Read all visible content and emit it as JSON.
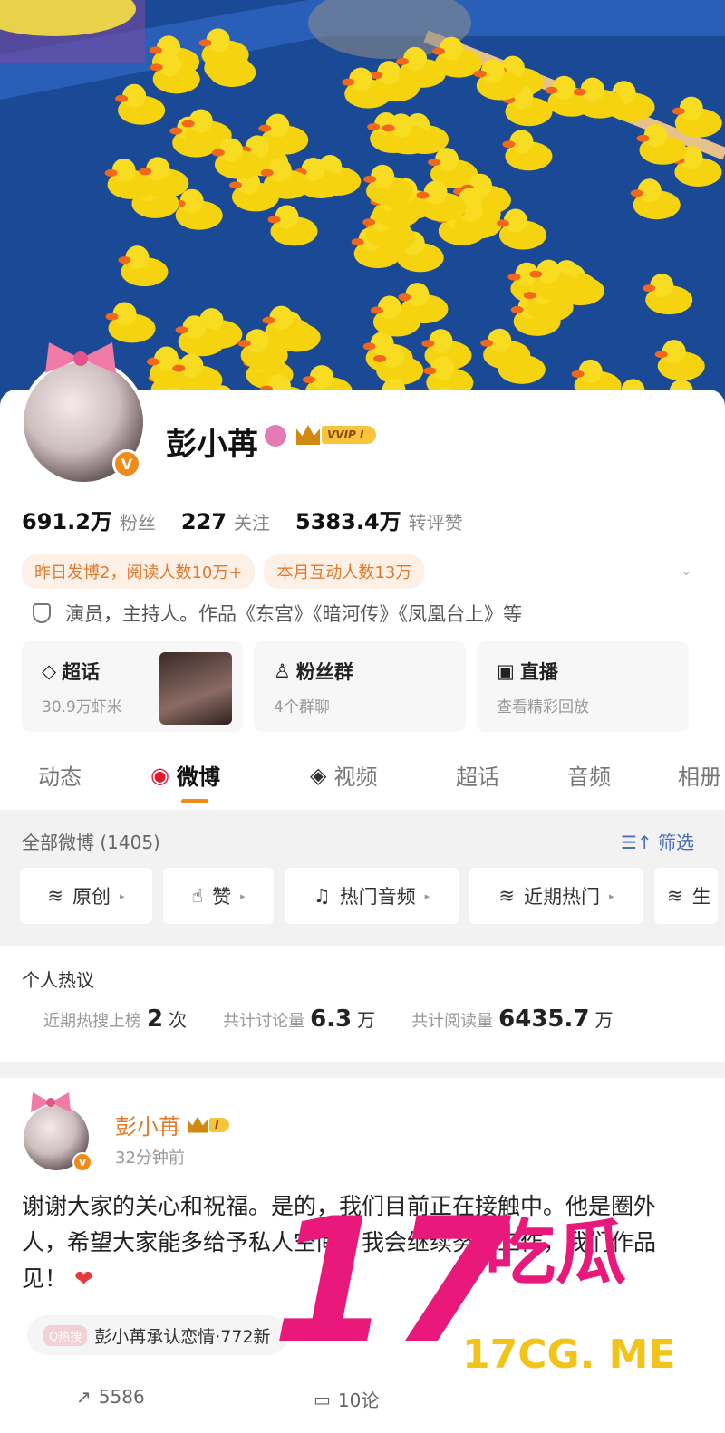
{
  "profile": {
    "name": "彭小苒",
    "verified_badge": "V",
    "vip_tag": "VVIP I",
    "stats": [
      {
        "value": "691.2万",
        "label": "粉丝"
      },
      {
        "value": "227",
        "label": "关注"
      },
      {
        "value": "5383.4万",
        "label": "转评赞"
      }
    ],
    "pills": [
      "昨日发博2，阅读人数10万+",
      "本月互动人数13万"
    ],
    "bio": "演员，主持人。作品《东宫》《暗河传》《凤凰台上》等",
    "features": [
      {
        "title": "超话",
        "sub": "30.9万虾米",
        "icon": "diamond-icon"
      },
      {
        "title": "粉丝群",
        "sub": "4个群聊",
        "icon": "group-icon"
      },
      {
        "title": "直播",
        "sub": "查看精彩回放",
        "icon": "tv-icon"
      }
    ]
  },
  "tabs": [
    "动态",
    "微博",
    "视频",
    "超话",
    "音频",
    "相册"
  ],
  "filter_bar": {
    "all_label": "全部微博 (1405)",
    "filter_label": "筛选",
    "chips": [
      "原创",
      "赞",
      "热门音频",
      "近期热门",
      "生"
    ]
  },
  "hot_topics": {
    "heading": "个人热议",
    "items": [
      {
        "label": "近期热搜上榜",
        "value": "2",
        "unit": "次"
      },
      {
        "label": "共计讨论量",
        "value": "6.3",
        "unit": "万"
      },
      {
        "label": "共计阅读量",
        "value": "6435.7",
        "unit": "万"
      }
    ]
  },
  "post": {
    "author": "彭小苒",
    "vip_level": "I",
    "time": "32分钟前",
    "text": "谢谢大家的关心和祝福。是的，我们目前正在接触中。他是圈外人，希望大家能多给予私人空间，我会继续努力工作，我们作品见！",
    "heart": "❤",
    "topic_badge": "Q热搜",
    "topic": "彭小苒承认恋情·772新",
    "repost_count": "5586",
    "comment_count": "10论"
  },
  "watermark": {
    "big": "17吃瓜",
    "site": "17CG. ME"
  }
}
